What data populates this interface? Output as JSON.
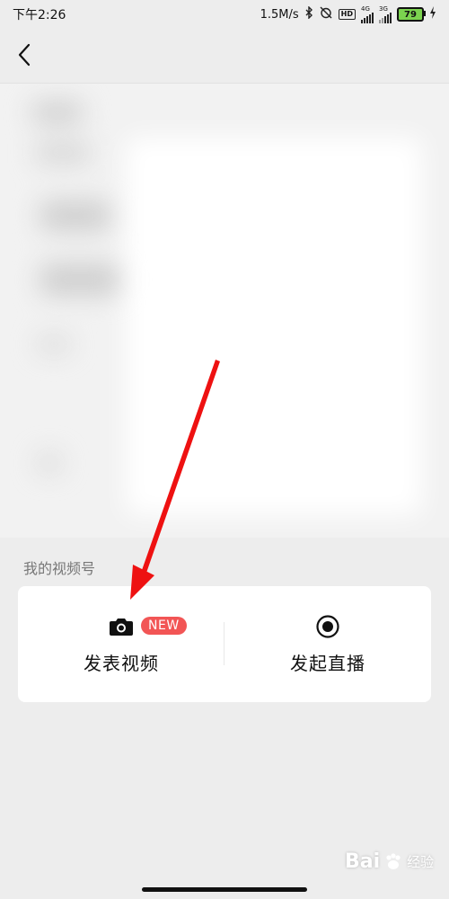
{
  "status_bar": {
    "time": "下午2:26",
    "net_speed": "1.5M/s",
    "hd": "HD",
    "sim1": "4G",
    "sim2": "3G",
    "battery": "79"
  },
  "section": {
    "label": "我的视频号"
  },
  "actions": [
    {
      "label": "发表视频",
      "badge": "NEW",
      "icon": "camera-icon"
    },
    {
      "label": "发起直播",
      "icon": "record-icon"
    }
  ],
  "annotation": {
    "color": "#ee1111"
  },
  "watermark": {
    "brand": "Bai",
    "suffix": "经验"
  }
}
